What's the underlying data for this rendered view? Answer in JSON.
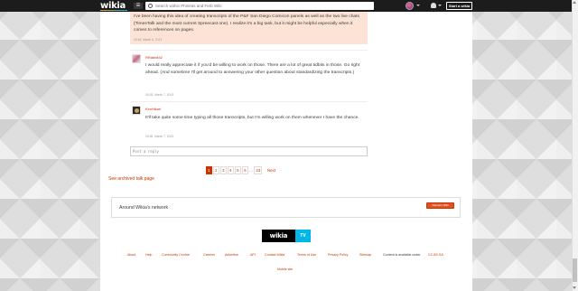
{
  "topbar": {
    "logo": "wikia",
    "hub_icon": "☰",
    "search_placeholder": "Search within Phineas and Ferb Wiki",
    "start_button": "Start a wikia"
  },
  "thread": {
    "highlight_text": "I've been having this idea of creating transcripts of the P&F San Diego Comicon panels as well as the two live chats (TimesTalk and the most current Spreecast one). I realize it's a big task, but it might be helpful especially when it comes to references on pages.",
    "highlight_timestamp": "03:48, March 6, 2013",
    "replies": [
      {
        "username": "RRabbit42",
        "text": "I would really appreciate it if you'd be willing to work on those. There are a lot of great tidbits in those. Go right ahead. (And sometime I'll get around to answering your other question about standardizing the transcripts.)",
        "timestamp": "04:25, March 7, 2013"
      },
      {
        "username": "KimHikari",
        "text": "It'll take quite some time typing all those transcripts, but I'm willing work on them whenever I have the chance.",
        "timestamp": "04:35, March 7, 2013"
      }
    ],
    "post_reply_placeholder": "Post a reply"
  },
  "pagination": {
    "pages": [
      "1",
      "2",
      "3",
      "4",
      "5",
      "6"
    ],
    "ellipsis": "...",
    "last": "23",
    "next": "Next"
  },
  "archived_link": "See archived talk page",
  "network": {
    "title": "Around Wikia's network",
    "button": "Random Wiki"
  },
  "wikia_tv": {
    "word": "wikia",
    "suffix": "TV"
  },
  "footer": {
    "links": [
      "About",
      "Help",
      "Community Central",
      "Careers",
      "Advertise",
      "API",
      "Contact Wikia",
      "Terms of Use",
      "Privacy Policy",
      "Sitemap"
    ],
    "license_text": "Content is available under",
    "license_link": "CC-BY-SA",
    "mobile": "Mobile site"
  },
  "colors": {
    "link": "#cc3300",
    "highlight_bg": "#fce3d6",
    "topbar": "#1c1c1c",
    "tv_blue": "#00b6e6"
  }
}
